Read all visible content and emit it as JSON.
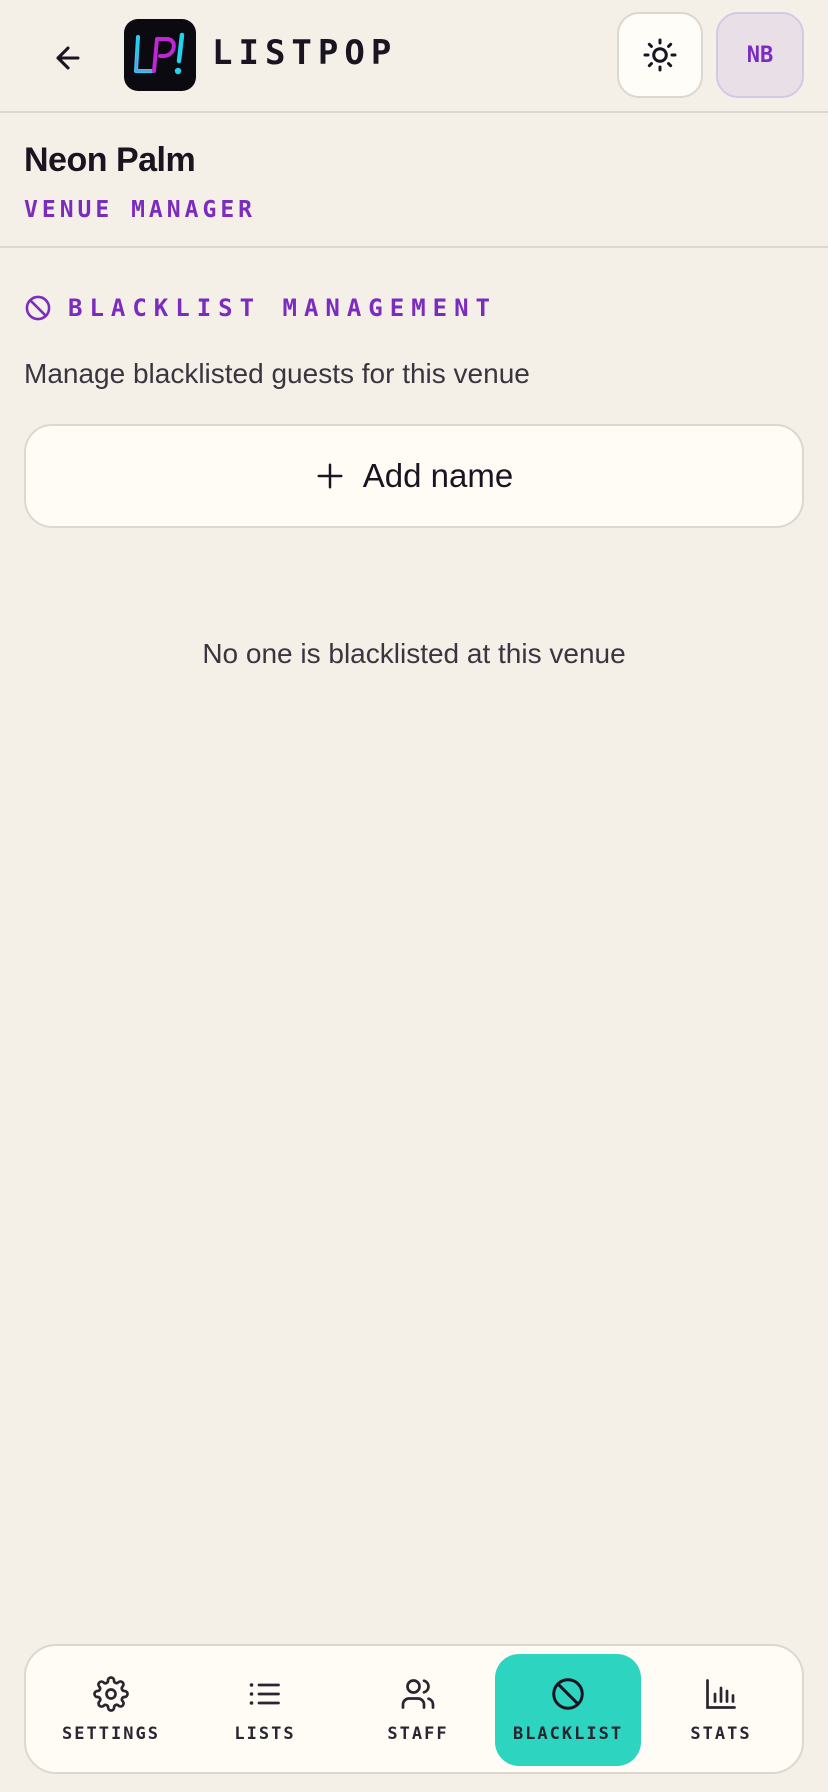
{
  "header": {
    "brand": "LISTPOP",
    "logo_text": "LP!",
    "avatar_initials": "NB"
  },
  "venue": {
    "name": "Neon Palm",
    "role": "VENUE MANAGER"
  },
  "blacklist": {
    "title": "BLACKLIST MANAGEMENT",
    "description": "Manage blacklisted guests for this venue",
    "add_label": "Add name",
    "empty_message": "No one is blacklisted at this venue"
  },
  "nav": {
    "items": [
      {
        "label": "SETTINGS",
        "icon": "gear-icon"
      },
      {
        "label": "LISTS",
        "icon": "list-icon"
      },
      {
        "label": "STAFF",
        "icon": "users-icon"
      },
      {
        "label": "BLACKLIST",
        "icon": "ban-icon",
        "active": true
      },
      {
        "label": "STATS",
        "icon": "bar-chart-icon"
      }
    ]
  },
  "colors": {
    "background": "#f4f0e8",
    "accent_purple": "#7b2cbf",
    "active_teal": "#2dd4bf",
    "text": "#1a1420"
  }
}
